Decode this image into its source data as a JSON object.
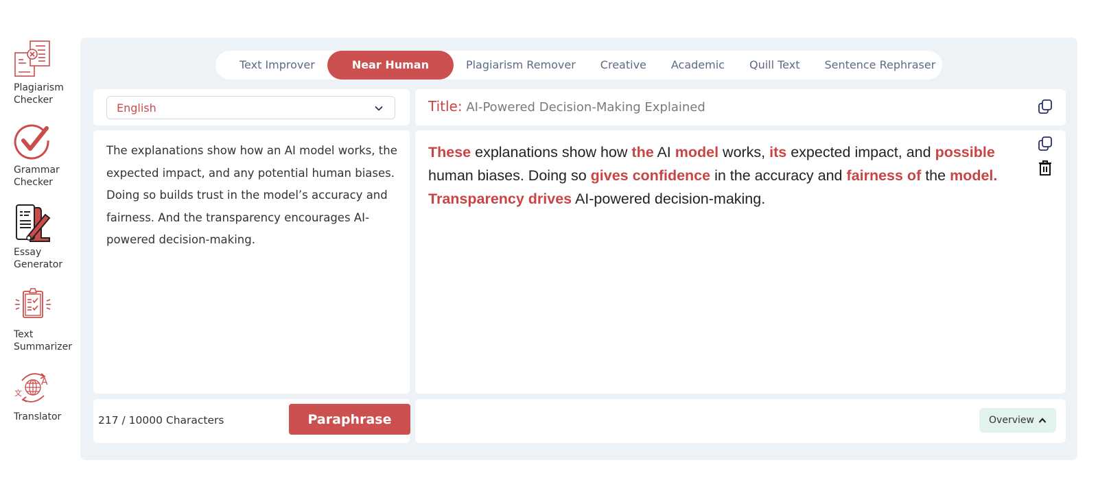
{
  "sidebar": {
    "items": [
      {
        "label": "Plagiarism\nChecker",
        "icon": "plagiarism-checker-icon"
      },
      {
        "label": "Grammar\nChecker",
        "icon": "grammar-check-icon"
      },
      {
        "label": "Essay\nGenerator",
        "icon": "essay-generator-icon"
      },
      {
        "label": "Text\nSummarizer",
        "icon": "clipboard-checklist-icon"
      },
      {
        "label": "Translator",
        "icon": "translate-globe-icon"
      }
    ]
  },
  "tabs": [
    {
      "label": "Text Improver",
      "active": false
    },
    {
      "label": "Near Human",
      "active": true
    },
    {
      "label": "Plagiarism Remover",
      "active": false
    },
    {
      "label": "Creative",
      "active": false
    },
    {
      "label": "Academic",
      "active": false
    },
    {
      "label": "Quill Text",
      "active": false
    },
    {
      "label": "Sentence Rephraser",
      "active": false
    }
  ],
  "language": {
    "selected": "English"
  },
  "title": {
    "key": "Title:",
    "value": "AI-Powered Decision-Making Explained"
  },
  "input": {
    "text": "The explanations show how an AI model works, the expected impact, and any potential human biases. Doing so builds trust in the model’s accuracy and fairness. And the transparency encourages AI-powered decision-making."
  },
  "output": {
    "segments": [
      {
        "text": "These",
        "changed": true
      },
      {
        "text": " explanations show how ",
        "changed": false
      },
      {
        "text": "the",
        "changed": true
      },
      {
        "text": " AI ",
        "changed": false
      },
      {
        "text": "model",
        "changed": true
      },
      {
        "text": " works, ",
        "changed": false
      },
      {
        "text": "its",
        "changed": true
      },
      {
        "text": " expected impact, and ",
        "changed": false
      },
      {
        "text": "possible",
        "changed": true
      },
      {
        "text": " human biases. Doing so ",
        "changed": false
      },
      {
        "text": "gives confidence",
        "changed": true
      },
      {
        "text": " in the accuracy and ",
        "changed": false
      },
      {
        "text": "fairness of",
        "changed": true
      },
      {
        "text": " the ",
        "changed": false
      },
      {
        "text": "model. Transparency drives",
        "changed": true
      },
      {
        "text": " AI-powered decision-making.",
        "changed": false
      }
    ]
  },
  "footer": {
    "char_count": "217 / 10000 Characters",
    "paraphrase_label": "Paraphrase",
    "overview_label": "Overview"
  },
  "colors": {
    "accent": "#cc5050",
    "highlight": "#c94444",
    "background": "#edf2f7",
    "tab_text": "#5c6b85",
    "overview_bg": "#e2f2ee"
  }
}
